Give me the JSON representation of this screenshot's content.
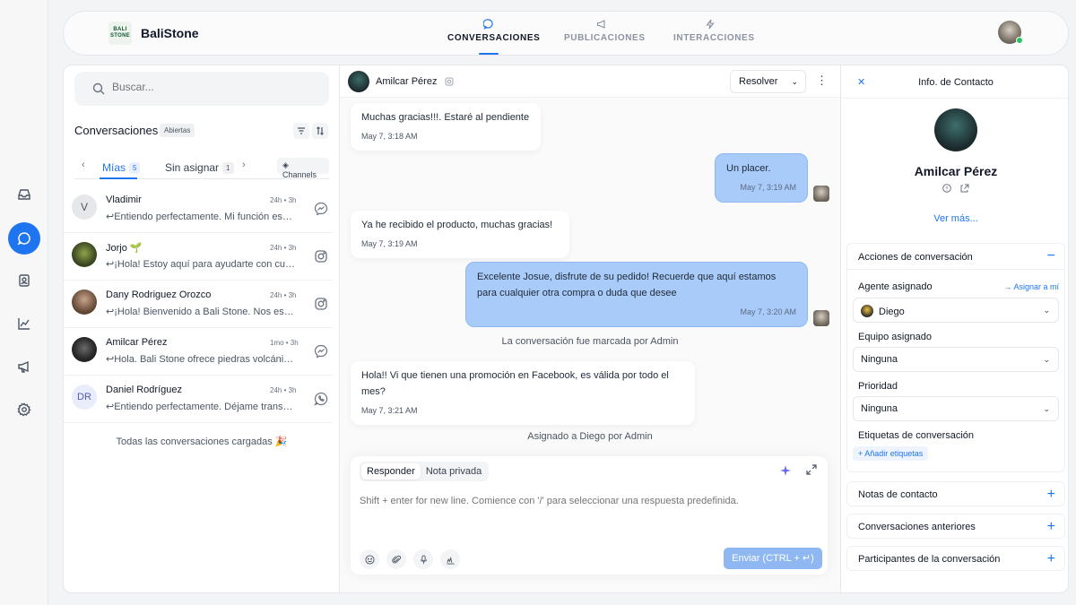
{
  "app": {
    "brand_name": "BaliStone",
    "brand_logo_line1": "BALI",
    "brand_logo_line2": "STONE"
  },
  "rail": {
    "items": [
      {
        "icon": "inbox-icon"
      },
      {
        "icon": "chat-icon",
        "active": true
      },
      {
        "icon": "contacts-icon"
      },
      {
        "icon": "reports-icon"
      },
      {
        "icon": "megaphone-icon"
      },
      {
        "icon": "settings-icon"
      }
    ]
  },
  "nav": {
    "tabs": [
      {
        "label": "CONVERSACIONES",
        "icon": "chat-bubble-icon",
        "active": true
      },
      {
        "label": "PUBLICACIONES",
        "icon": "megaphone-icon"
      },
      {
        "label": "INTERACCIONES",
        "icon": "lightning-icon"
      }
    ]
  },
  "list": {
    "search_placeholder": "Buscar...",
    "title": "Conversaciones",
    "status_badge": "Abiertas",
    "tabs": [
      {
        "label": "Mías",
        "count": "5",
        "active": true
      },
      {
        "label": "Sin asignar",
        "count": "1"
      }
    ],
    "channels_label": "Channels",
    "items": [
      {
        "name": "Vladimir",
        "time": "24h • 3h",
        "preview": "↩Entiendo perfectamente. Mi función es…",
        "avatar_text": "V",
        "channel": "messenger-icon"
      },
      {
        "name": "Jorjo",
        "name_emoji": "🌱",
        "time": "24h • 3h",
        "preview": "↩¡Hola! Estoy aquí para ayudarte con cu…",
        "avatar_text": "",
        "channel": "instagram-icon"
      },
      {
        "name": "Dany Rodriguez Orozco",
        "time": "24h • 3h",
        "preview": "↩¡Hola! Bienvenido a Bali Stone. Nos es…",
        "avatar_text": "",
        "channel": "instagram-icon"
      },
      {
        "name": "Amilcar Pérez",
        "time": "1mo • 3h",
        "preview": "↩Hola. Bali Stone ofrece piedras volcáni…",
        "avatar_text": "",
        "channel": "messenger-icon"
      },
      {
        "name": "Daniel Rodríguez",
        "time": "24h • 3h",
        "preview": "↩Entiendo perfectamente. Déjame trans…",
        "avatar_text": "DR",
        "channel": "whatsapp-icon"
      }
    ],
    "footer": "Todas las conversaciones cargadas 🎉"
  },
  "chat": {
    "contact_name": "Amilcar Pérez",
    "resolve_label": "Resolver",
    "messages": [
      {
        "direction": "in",
        "text": "Muchas gracias!!!. Estaré al pendiente",
        "time": "May 7, 3:18 AM"
      },
      {
        "direction": "out",
        "text": "Un placer.",
        "time": "May 7, 3:19 AM"
      },
      {
        "direction": "in",
        "text": "Ya he recibido el producto, muchas gracias!",
        "time": "May 7, 3:19 AM"
      },
      {
        "direction": "out",
        "text": "Excelente Josue, disfrute de su pedido! Recuerde que aquí estamos para cualquier otra compra o duda que desee",
        "time": "May 7, 3:20 AM"
      },
      {
        "direction": "in",
        "text": "Hola!! Vi que tienen una promoción en Facebook, es válida por todo el mes?",
        "time": "May 7, 3:21 AM"
      }
    ],
    "activity_1": "La conversación fue marcada por Admin",
    "activity_2": "Asignado a Diego por Admin",
    "composer": {
      "tab_reply": "Responder",
      "tab_note": "Nota privada",
      "placeholder": "Shift + enter for new line. Comience con '/' para seleccionar una respuesta predefinida.",
      "send_label": "Enviar (CTRL + ↵)"
    }
  },
  "contact": {
    "title": "Info. de Contacto",
    "name": "Amilcar Pérez",
    "see_more": "Ver más...",
    "actions_title": "Acciones de conversación",
    "agent_label": "Agente asignado",
    "assign_me": "→ Asignar a mí",
    "agent_value": "Diego",
    "team_label": "Equipo asignado",
    "team_value": "Ninguna",
    "priority_label": "Prioridad",
    "priority_value": "Ninguna",
    "tags_label": "Etiquetas de conversación",
    "add_tags": "+ Añadir etiquetas",
    "sections": [
      "Notas de contacto",
      "Conversaciones anteriores",
      "Participantes de la conversación"
    ]
  },
  "colors": {
    "accent": "#1f75f0",
    "outgoing_bubble": "#a9cbf9",
    "online": "#22c55e"
  }
}
